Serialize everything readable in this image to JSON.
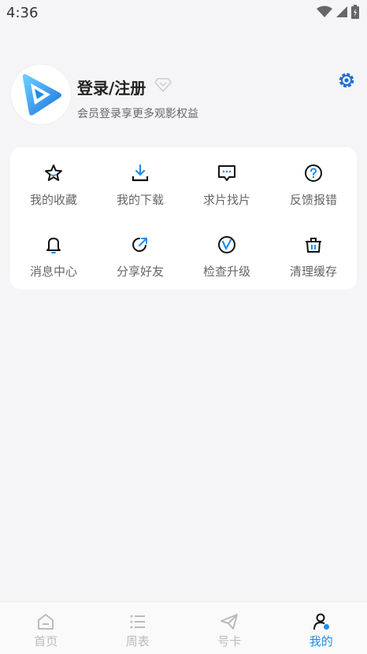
{
  "status": {
    "time": "4:36"
  },
  "profile": {
    "title": "登录/注册",
    "subtitle": "会员登录享更多观影权益"
  },
  "menu": [
    {
      "label": "我的收藏",
      "icon": "star-icon"
    },
    {
      "label": "我的下载",
      "icon": "download-icon"
    },
    {
      "label": "求片找片",
      "icon": "message-icon"
    },
    {
      "label": "反馈报错",
      "icon": "question-icon"
    },
    {
      "label": "消息中心",
      "icon": "bell-icon"
    },
    {
      "label": "分享好友",
      "icon": "share-icon"
    },
    {
      "label": "检查升级",
      "icon": "upgrade-icon"
    },
    {
      "label": "清理缓存",
      "icon": "trash-icon"
    }
  ],
  "tabs": [
    {
      "label": "首页",
      "icon": "home-icon"
    },
    {
      "label": "周表",
      "icon": "list-icon"
    },
    {
      "label": "号卡",
      "icon": "paper-plane-icon"
    },
    {
      "label": "我的",
      "icon": "user-icon"
    }
  ],
  "colors": {
    "accent": "#1f8cf0",
    "background": "#f5f5f7",
    "card": "#ffffff",
    "inactive": "#bbbbbb"
  }
}
